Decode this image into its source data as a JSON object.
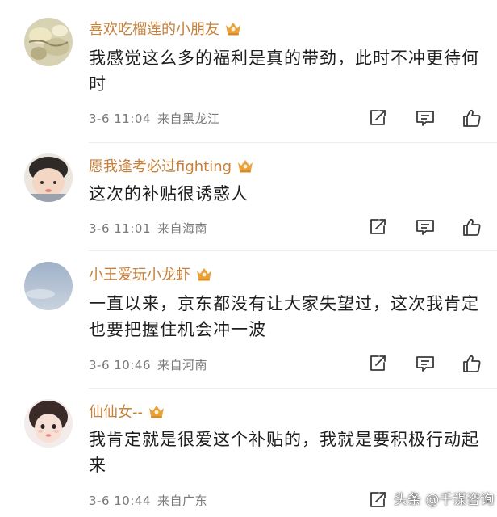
{
  "comments": [
    {
      "username": "喜欢吃榴莲的小朋友",
      "text": "我感觉这么多的福利是真的带劲，此时不冲更待何时",
      "time": "3-6 11:04",
      "location": "来自黑龙江",
      "avatar": "durian-food-photo"
    },
    {
      "username": "愿我逢考必过fighting",
      "text": "这次的补贴很诱惑人",
      "time": "3-6 11:01",
      "location": "来自海南",
      "avatar": "child-photo"
    },
    {
      "username": "小王爱玩小龙虾",
      "text": "一直以来，京东都没有让大家失望过，这次我肯定也要把握住机会冲一波",
      "time": "3-6 10:46",
      "location": "来自河南",
      "avatar": "sky-photo"
    },
    {
      "username": "仙仙女--",
      "text": "我肯定就是很爱这个补贴的，我就是要积极行动起来",
      "time": "3-6 10:44",
      "location": "来自广东",
      "avatar": "girl-photo"
    }
  ],
  "badge_icon": "crown-vip-icon",
  "action_icons": [
    "share-icon",
    "comment-icon",
    "thumbs-up-icon"
  ],
  "watermark": "头条 @千谋咨询",
  "colors": {
    "username": "#c7803a",
    "text": "#1e1e1e",
    "meta": "#7a7a7a",
    "icon": "#3a3a3a",
    "crown": "#e9a23b"
  }
}
